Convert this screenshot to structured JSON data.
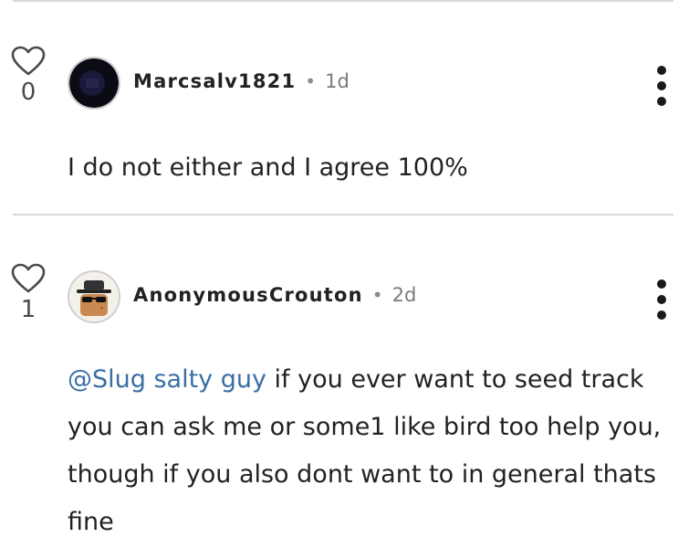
{
  "comments": [
    {
      "likes": "0",
      "author": "Marcsalv1821",
      "separator": "•",
      "time": "1d",
      "body": "I do not either and I agree 100%"
    },
    {
      "likes": "1",
      "author": "AnonymousCrouton",
      "separator": "•",
      "time": "2d",
      "mention": "@Slug salty guy",
      "body": " if you ever want to seed track you can ask me or some1 like bird too help you, though if you also dont want to in general thats fine"
    }
  ],
  "colors": {
    "mention": "#3a6ea5",
    "divider": "#d8d8d8",
    "meta": "#7a7a7a"
  },
  "icons": [
    "heart-icon",
    "more-options-icon",
    "avatar"
  ]
}
